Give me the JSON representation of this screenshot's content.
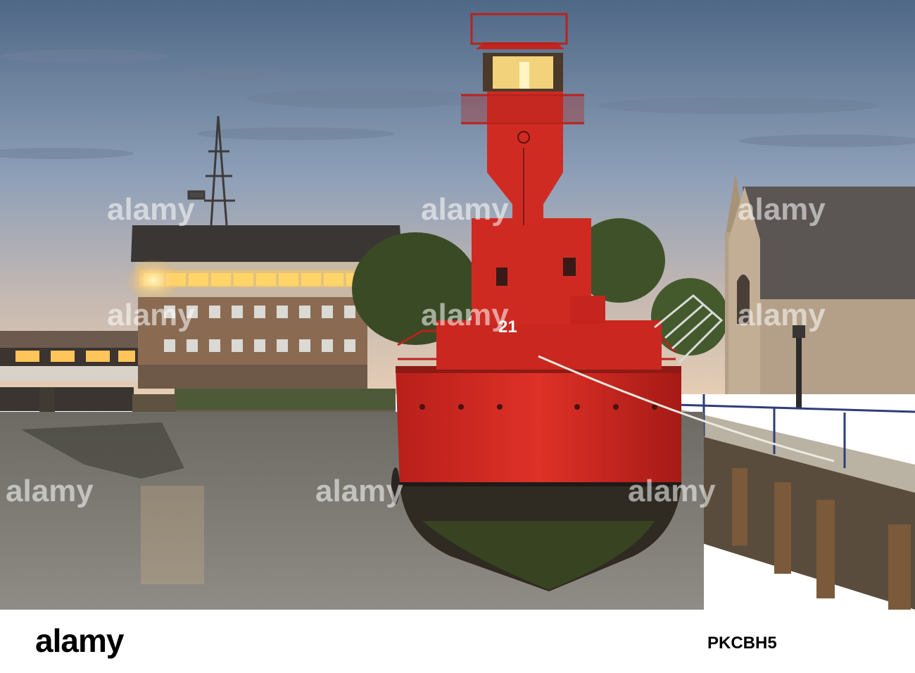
{
  "photo": {
    "hull_number": "21",
    "watermark": "alamy"
  },
  "footer": {
    "logo": "alamy",
    "image_id": "PKCBH5"
  },
  "colors": {
    "sky_top": "#5d7590",
    "sky_horizon": "#d9c3b0",
    "hull_red": "#d42a24",
    "water": "#7f7d78",
    "brick": "#8a6b52",
    "window_glow": "#ffcf5a"
  }
}
